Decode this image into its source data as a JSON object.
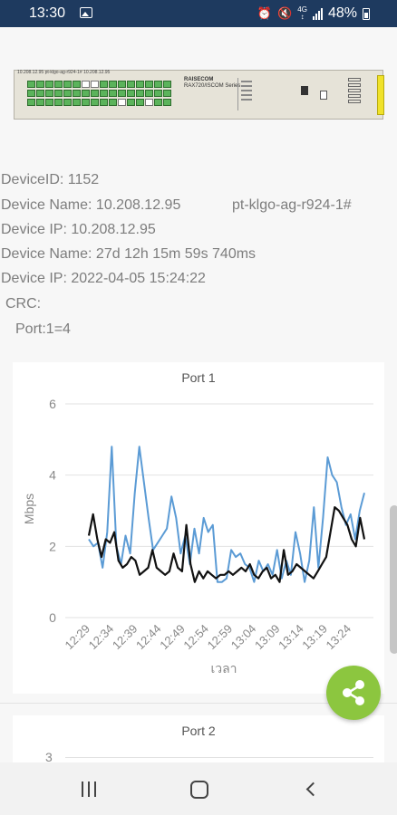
{
  "status_bar": {
    "time": "13:30",
    "battery": "48%"
  },
  "device_image": {
    "panel_label": "10.208.12.95  pt-klgo-ag-r924-1#  10.208.12.95",
    "brand": "RAISECOM",
    "model": "RAX720/ISCOM Series"
  },
  "info": {
    "device_id": "DeviceID: 1152",
    "device_name": "Device Name: 10.208.12.95",
    "hostname": "pt-klgo-ag-r924-1#",
    "device_ip": "Device IP: 10.208.12.95",
    "uptime": "Device Name: 27d 12h 15m 59s 740ms",
    "timestamp": "Device IP: 2022-04-05 15:24:22",
    "crc": "CRC:",
    "port": "Port:1=4"
  },
  "chart_data": [
    {
      "type": "line",
      "title": "Port 1",
      "xlabel": "เวลา",
      "ylabel": "Mbps",
      "ylim": [
        0,
        6
      ],
      "yticks": [
        "0",
        "2",
        "4",
        "6"
      ],
      "xticks": [
        "12:29",
        "12:34",
        "12:39",
        "12:44",
        "12:49",
        "12:54",
        "12:59",
        "13:04",
        "13:09",
        "13:14",
        "13:19",
        "13:24"
      ],
      "grid": true,
      "series": [
        {
          "color": "#5b9bd5",
          "values": [
            2.2,
            2.0,
            2.1,
            1.4,
            2.4,
            4.8,
            2.0,
            1.5,
            2.3,
            1.8,
            3.5,
            4.8,
            3.8,
            2.8,
            1.9,
            2.1,
            2.3,
            2.5,
            3.4,
            2.8,
            1.8,
            2.3,
            1.5,
            2.5,
            1.8,
            2.8,
            2.4,
            2.6,
            1.0,
            1.0,
            1.1,
            1.9,
            1.7,
            1.8,
            1.5,
            1.4,
            1.0,
            1.6,
            1.3,
            1.5,
            1.2,
            1.9,
            1.1,
            1.6,
            1.2,
            2.4,
            1.8,
            1.0,
            1.6,
            3.1,
            1.4,
            2.8,
            4.5,
            4.0,
            3.8,
            3.1,
            2.6,
            2.9,
            2.2,
            3.0,
            3.5
          ]
        },
        {
          "color": "#111111",
          "values": [
            2.3,
            2.9,
            2.2,
            1.7,
            2.2,
            2.1,
            2.4,
            1.6,
            1.4,
            1.5,
            1.7,
            1.6,
            1.2,
            1.3,
            1.4,
            1.9,
            1.4,
            1.3,
            1.2,
            1.3,
            1.8,
            1.4,
            1.3,
            2.6,
            1.5,
            1.0,
            1.3,
            1.1,
            1.3,
            1.2,
            1.1,
            1.2,
            1.2,
            1.3,
            1.2,
            1.3,
            1.4,
            1.3,
            1.5,
            1.2,
            1.1,
            1.3,
            1.4,
            1.1,
            1.2,
            1.0,
            1.9,
            1.2,
            1.3,
            1.5,
            1.4,
            1.3,
            1.2,
            1.1,
            1.3,
            1.5,
            1.7,
            2.4,
            3.1,
            3.0,
            2.8,
            2.6,
            2.2,
            2.0,
            2.8,
            2.2
          ]
        }
      ]
    },
    {
      "type": "line",
      "title": "Port 2",
      "yticks": [
        "3"
      ]
    }
  ]
}
